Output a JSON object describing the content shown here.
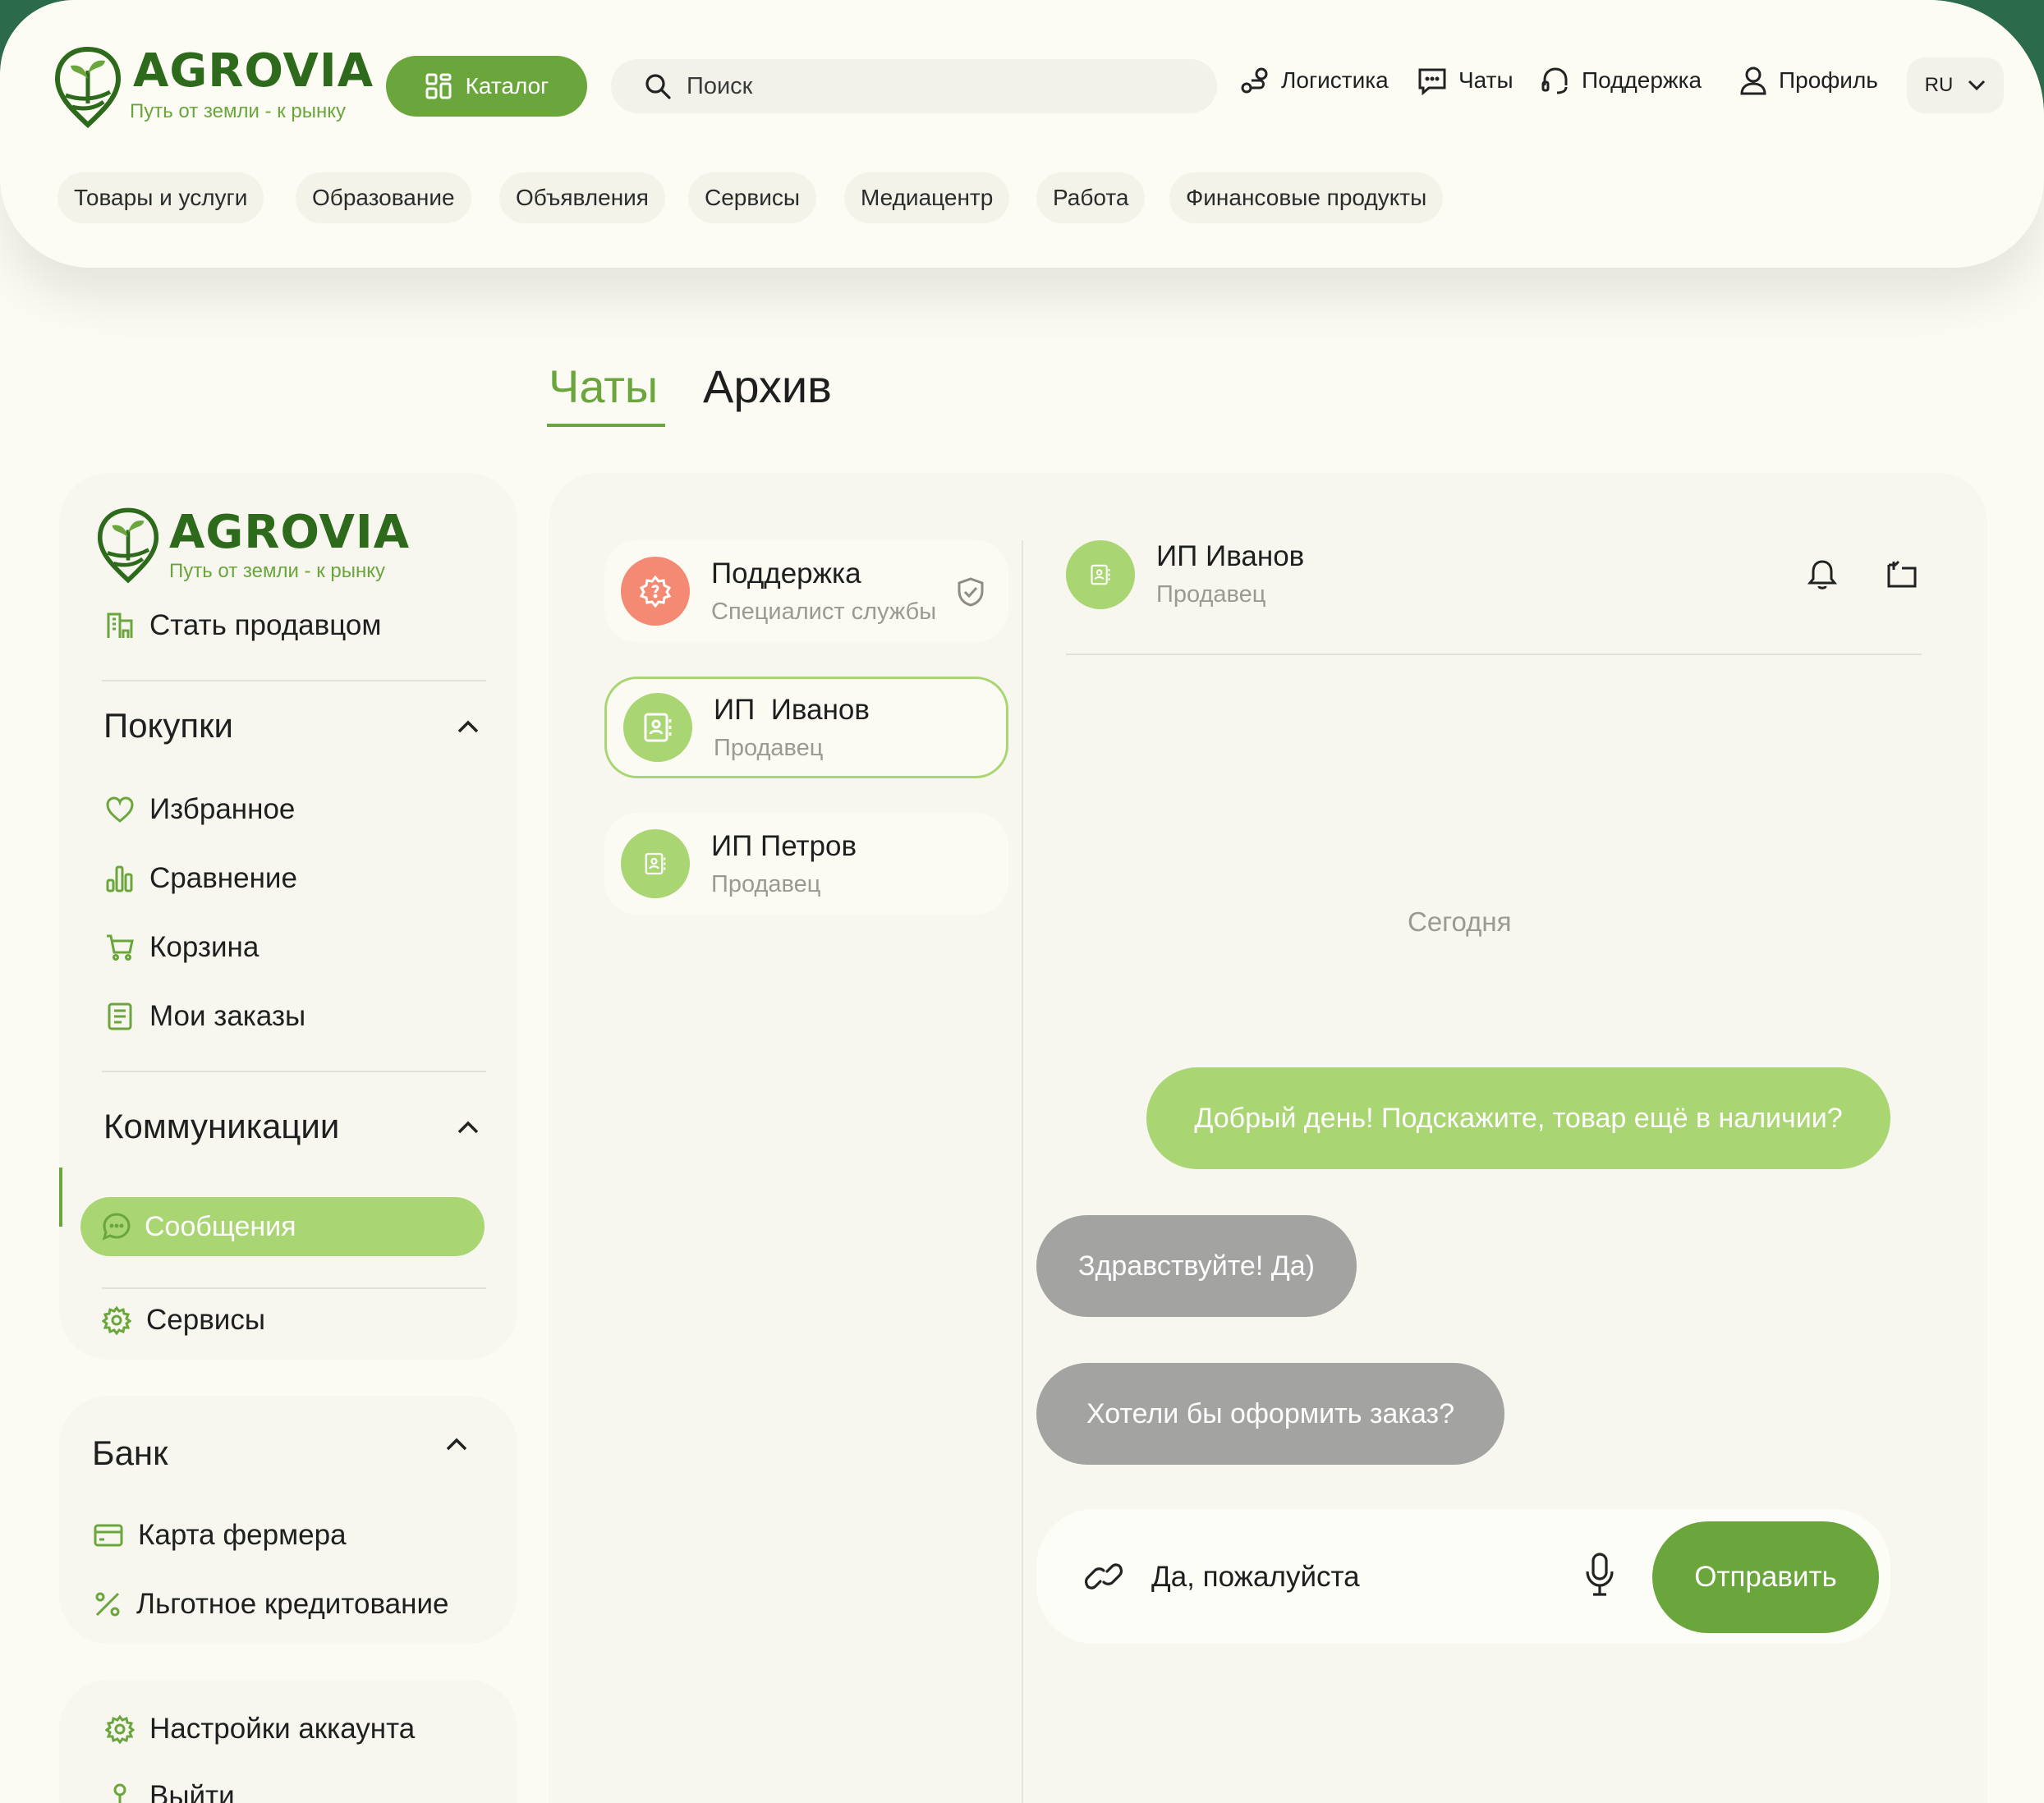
{
  "brand": {
    "name": "AGROVIA",
    "tagline": "Путь от земли - к рынку",
    "color_primary": "#6aa63c",
    "color_light": "#a9d572",
    "color_dark": "#2d6a1c"
  },
  "header": {
    "catalog_label": "Каталог",
    "search_placeholder": "Поиск",
    "nav": [
      {
        "label": "Логистика",
        "icon": "logistics-icon"
      },
      {
        "label": "Чаты",
        "icon": "chat-icon"
      },
      {
        "label": "Поддержка",
        "icon": "support-icon"
      },
      {
        "label": "Профиль",
        "icon": "user-icon"
      }
    ],
    "language": "RU",
    "categories": [
      "Товары и услуги",
      "Образование",
      "Объявления",
      "Сервисы",
      "Медиацентр",
      "Работа",
      "Финансовые продукты"
    ]
  },
  "tabs": {
    "chats": "Чаты",
    "archive": "Архив",
    "active": "chats"
  },
  "sidebar": {
    "become_seller": "Стать продавцом",
    "purchases": {
      "title": "Покупки",
      "items": [
        "Избранное",
        "Сравнение",
        "Корзина",
        "Мои заказы"
      ]
    },
    "communications": {
      "title": "Коммуникации",
      "items": [
        "Сообщения",
        "Сервисы"
      ],
      "active": "Сообщения"
    },
    "bank": {
      "title": "Банк",
      "items": [
        "Карта фермера",
        "Льготное кредитование"
      ]
    },
    "account": {
      "items": [
        "Настройки аккаунта",
        "Выйти"
      ]
    }
  },
  "chat_list": [
    {
      "name": "Поддержка",
      "role": "Специалист службы",
      "avatar_color": "#f58a74",
      "verified": true
    },
    {
      "name": "ИП  Иванов",
      "role": "Продавец",
      "avatar_color": "#a9d572",
      "active": true
    },
    {
      "name": "ИП Петров",
      "role": "Продавец",
      "avatar_color": "#a9d572"
    }
  ],
  "conversation": {
    "name": "ИП Иванов",
    "role": "Продавец",
    "date_divider": "Сегодня",
    "messages": [
      {
        "text": "Добрый день! Подскажите, товар ещё в наличии?",
        "from": "me"
      },
      {
        "text": "Здравствуйте! Да)",
        "from": "them"
      },
      {
        "text": "Хотели бы оформить заказ?",
        "from": "them"
      }
    ],
    "draft": "Да, пожалуйста",
    "send_label": "Отправить"
  }
}
